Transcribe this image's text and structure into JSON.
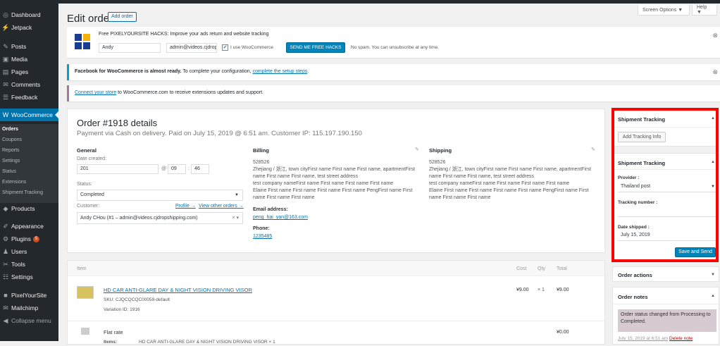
{
  "sidebar": {
    "items": [
      {
        "label": "Dashboard",
        "icon": "dashboard-icon",
        "glyph": "◎"
      },
      {
        "label": "Jetpack",
        "icon": "jetpack-icon",
        "glyph": "⚡"
      },
      {
        "label": "Posts",
        "icon": "pin-icon",
        "glyph": "✎"
      },
      {
        "label": "Media",
        "icon": "media-icon",
        "glyph": "▣"
      },
      {
        "label": "Pages",
        "icon": "pages-icon",
        "glyph": "▤"
      },
      {
        "label": "Comments",
        "icon": "comments-icon",
        "glyph": "✉"
      },
      {
        "label": "Feedback",
        "icon": "feedback-icon",
        "glyph": "☰"
      },
      {
        "label": "WooCommerce",
        "icon": "woocommerce-icon",
        "glyph": "W"
      },
      {
        "label": "Products",
        "icon": "products-icon",
        "glyph": "◆"
      },
      {
        "label": "Appearance",
        "icon": "appearance-icon",
        "glyph": "✐"
      },
      {
        "label": "Plugins",
        "icon": "plugins-icon",
        "glyph": "⚙",
        "badge": "5"
      },
      {
        "label": "Users",
        "icon": "users-icon",
        "glyph": "♟"
      },
      {
        "label": "Tools",
        "icon": "tools-icon",
        "glyph": "✂"
      },
      {
        "label": "Settings",
        "icon": "settings-icon",
        "glyph": "☷"
      },
      {
        "label": "PixelYourSite",
        "icon": "pixelyoursite-icon",
        "glyph": "■"
      },
      {
        "label": "Mailchimp",
        "icon": "mailchimp-icon",
        "glyph": "✉"
      },
      {
        "label": "Collapse menu",
        "icon": "collapse-icon",
        "glyph": "◀"
      }
    ],
    "submenu": [
      "Orders",
      "Coupons",
      "Reports",
      "Settings",
      "Status",
      "Extensions",
      "Shipment Tracking"
    ]
  },
  "top": {
    "screen_options": "Screen Options ▼",
    "help": "Help ▼"
  },
  "page": {
    "title": "Edit order",
    "add_order": "Add order"
  },
  "notices": {
    "pys_title": "Free PIXELYOURSITE HACKS: Improve your ads return and website tracking",
    "pys_name": "Andy",
    "pys_email": "admin@videos.cjdropshi",
    "pys_checkbox": "I use WooCommerce",
    "pys_button": "SEND ME FREE HACKS",
    "pys_spam": "No spam. You can unsubscribe at any time.",
    "fb_bold": "Facebook for WooCommerce is almost ready.",
    "fb_text": "To complete your configuration,",
    "fb_link": "complete the setup steps",
    "fb_dot": ".",
    "connect_link": "Connect your store",
    "connect_text": "to WooCommerce.com to receive extensions updates and support."
  },
  "order": {
    "title": "Order #1918 details",
    "subtitle": "Payment via Cash on delivery. Paid on July 15, 2019 @ 6:51 am. Customer IP: 115.197.190.150",
    "general": "General",
    "date_label": "Date created:",
    "date_value": "201",
    "at": "@",
    "hour": "09",
    "minute": "46",
    "status_label": "Status:",
    "status_value": "Completed",
    "customer_label": "Customer:",
    "profile_link": "Profile →",
    "view_orders_link": "View other orders →",
    "customer_value": "Andy CHou (#1 – admin@videos.cjdropshipping.com)",
    "billing": "Billing",
    "billing_lines": [
      "528526",
      "Zhejiang / 浙江, town cityFirst name First name First name, apartmentFirst",
      "name First name First name, test street address",
      "test company nameFirst name First name First name First name",
      "Elaine First name First name First name First name PengFirst name First",
      "name First name First name"
    ],
    "email_label": "Email address:",
    "email_value": "peng_hai_yan@163.com",
    "phone_label": "Phone:",
    "phone_value": "1235485",
    "shipping": "Shipping",
    "shipping_lines": [
      "528526",
      "Zhejiang / 浙江, town cityFirst name First name First name, apartmentFirst",
      "name First name First name, test street address",
      "test company nameFirst name First name First name First name",
      "Elaine First name First name First name First name PengFirst name First",
      "name First name First name"
    ]
  },
  "items": {
    "headers": {
      "item": "Item",
      "cost": "Cost",
      "qty": "Qty",
      "total": "Total"
    },
    "product_name": "HD CAR ANTI-GLARE DAY & NIGHT VISION DRIVING VISOR",
    "sku": "SKU: CJQCQCQC00059-default",
    "variation": "Variation ID: 1916",
    "cost": "¥9.00",
    "qty": "× 1",
    "total": "¥9.00",
    "shipping_name": "Flat rate",
    "shipping_items_label": "Items:",
    "shipping_items_value": "HD CAR ANTI-GLARE DAY & NIGHT VISION DRIVING VISOR × 1",
    "shipping_total": "¥0.00"
  },
  "tracking1": {
    "title": "Shipment Tracking",
    "button": "Add Tracking Info"
  },
  "tracking2": {
    "title": "Shipment Tracking",
    "provider_label": "Provider :",
    "provider_value": "Thailand post",
    "number_label": "Tracking number :",
    "number_value": "",
    "date_label": "Date shipped :",
    "date_value": "July 15, 2019",
    "button": "Save and Send"
  },
  "actions": {
    "title": "Order actions"
  },
  "notes": {
    "title": "Order notes",
    "note_text": "Order status changed from Processing to Completed.",
    "note_meta": "July 15, 2019 at 6:51 am",
    "delete": "Delete note"
  },
  "colors": {
    "accent": "#0073aa",
    "primary_button": "#0085ba",
    "highlight": "#ff0000",
    "note_bg": "#d7cad2"
  }
}
